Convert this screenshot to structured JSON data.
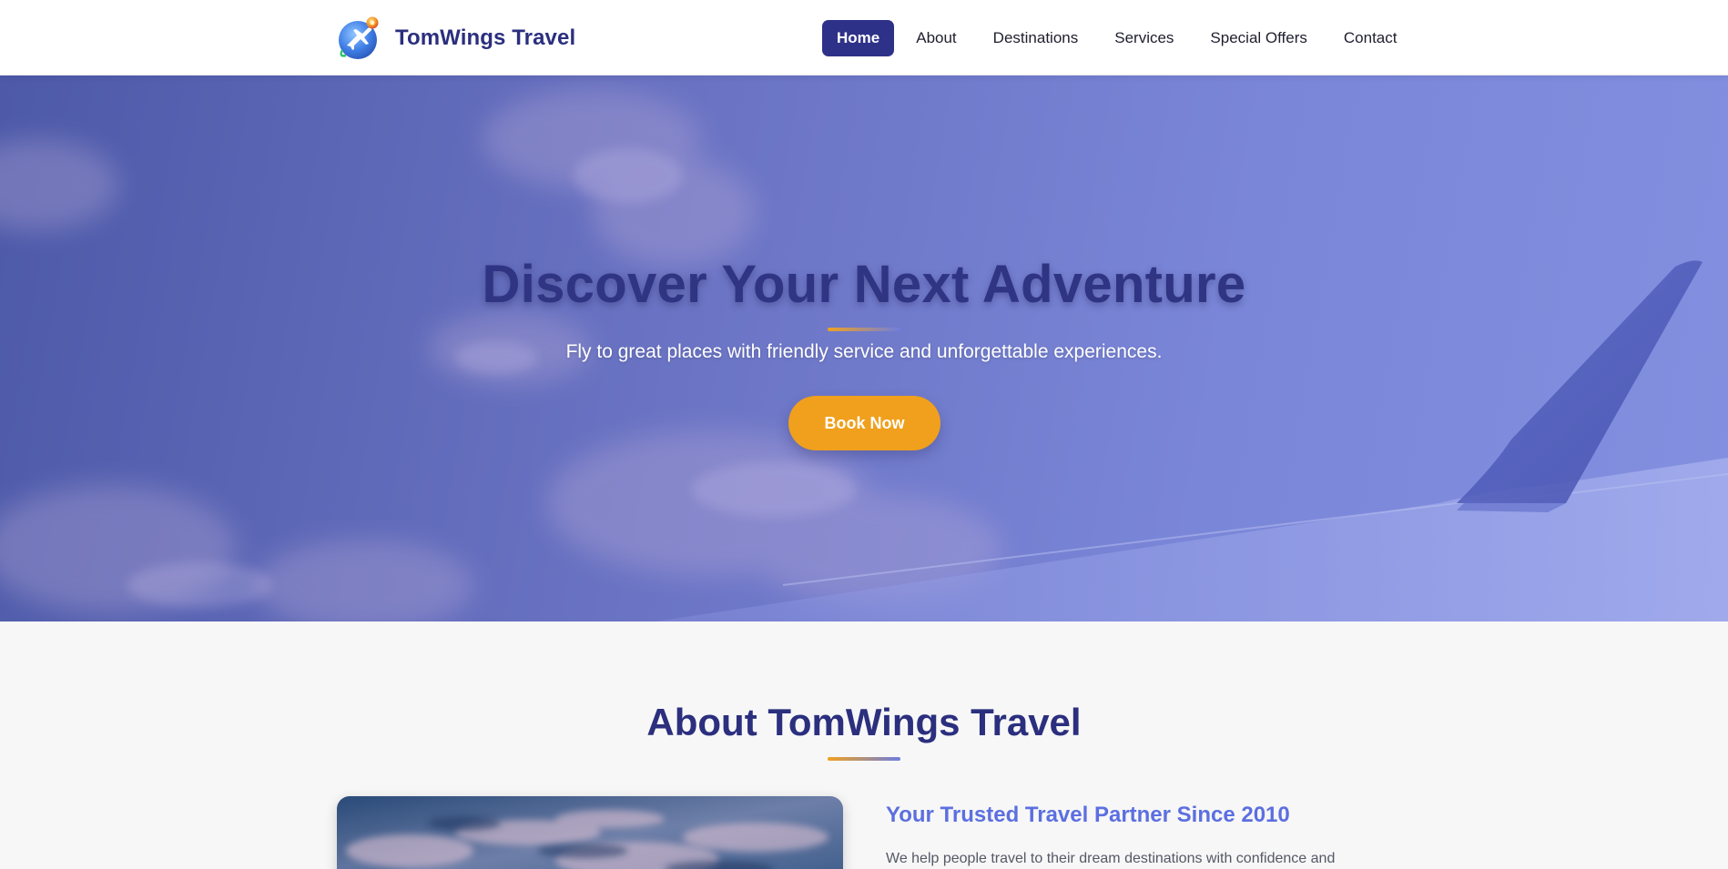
{
  "brand": {
    "name": "TomWings Travel",
    "logo_icon": "globe-airplane-icon"
  },
  "nav": {
    "items": [
      {
        "label": "Home",
        "active": true
      },
      {
        "label": "About",
        "active": false
      },
      {
        "label": "Destinations",
        "active": false
      },
      {
        "label": "Services",
        "active": false
      },
      {
        "label": "Special Offers",
        "active": false
      },
      {
        "label": "Contact",
        "active": false
      }
    ]
  },
  "hero": {
    "title": "Discover Your Next Adventure",
    "subtitle": "Fly to great places with friendly service and unforgettable experiences.",
    "cta_label": "Book Now"
  },
  "about": {
    "title": "About TomWings Travel",
    "heading": "Your Trusted Travel Partner Since 2010",
    "text": "We help people travel to their dream destinations with confidence and"
  },
  "colors": {
    "brand_navy": "#2e3188",
    "accent_orange": "#f0a01c",
    "accent_blue": "#5c6fe0",
    "hero_overlay": "#6b74c4"
  }
}
